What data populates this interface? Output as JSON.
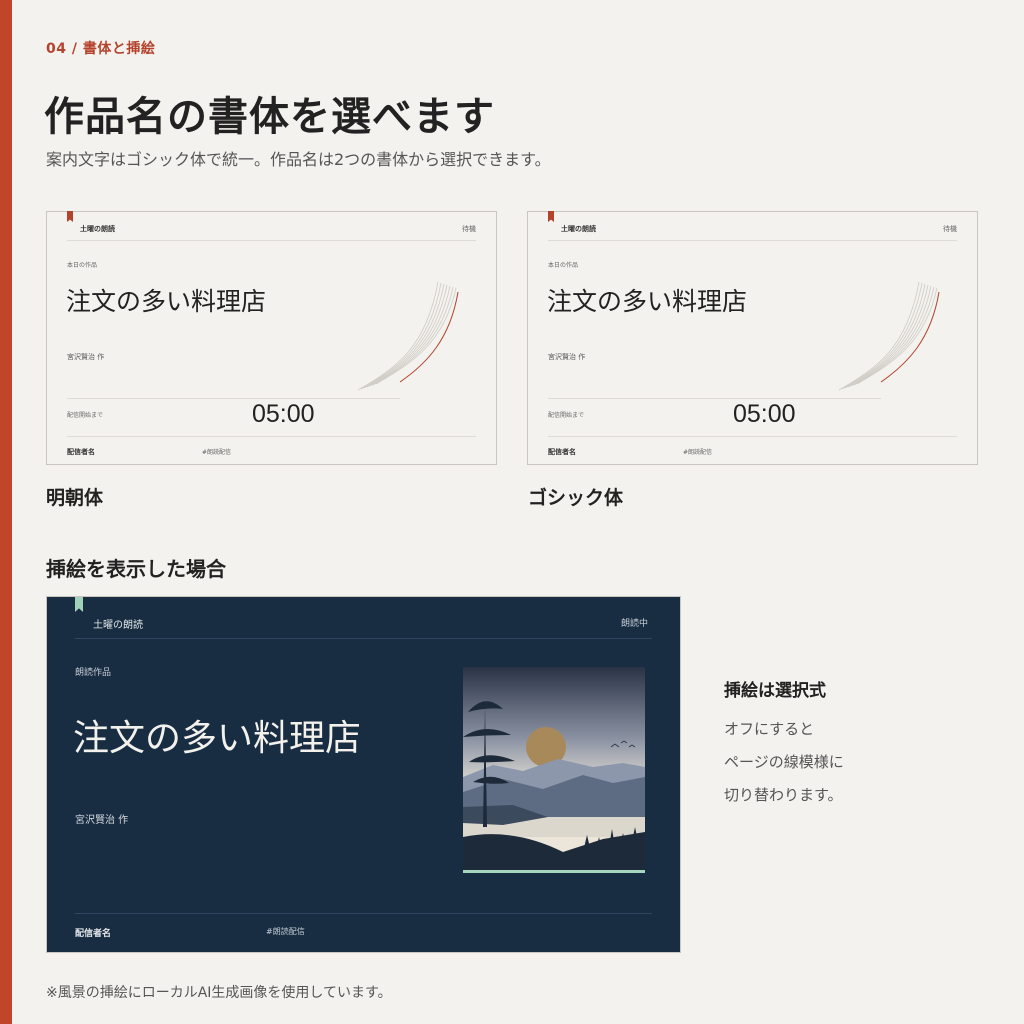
{
  "header": {
    "kicker": "04 / 書体と挿絵",
    "title": "作品名の書体を選べます",
    "subtitle": "案内文字はゴシック体で統一。作品名は2つの書体から選択できます。"
  },
  "previews": [
    {
      "brand": "土曜の朗読",
      "state": "待機",
      "label_today": "本日の作品",
      "work_title": "注文の多い料理店",
      "author": "宮沢賢治 作",
      "countdown_label": "配信開始まで",
      "countdown": "05:00",
      "streamer": "配信者名",
      "tag": "#朗読配信",
      "caption": "明朝体"
    },
    {
      "brand": "土曜の朗読",
      "state": "待機",
      "label_today": "本日の作品",
      "work_title": "注文の多い料理店",
      "author": "宮沢賢治 作",
      "countdown_label": "配信開始まで",
      "countdown": "05:00",
      "streamer": "配信者名",
      "tag": "#朗読配信",
      "caption": "ゴシック体"
    }
  ],
  "illustrated": {
    "section_title": "挿絵を表示した場合",
    "brand": "土曜の朗読",
    "state": "朗読中",
    "label_work": "朗読作品",
    "work_title": "注文の多い料理店",
    "author": "宮沢賢治 作",
    "streamer": "配信者名",
    "tag": "#朗読配信"
  },
  "side_note": {
    "title": "挿絵は選択式",
    "lines": [
      "オフにすると",
      "ページの線模様に",
      "切り替わります。"
    ]
  },
  "footnote": "※風景の挿絵にローカルAI生成画像を使用しています。",
  "colors": {
    "accent": "#c0452b",
    "background": "#f4f2ee",
    "dark_card": "#182c42",
    "mint": "#a6d6bd"
  }
}
